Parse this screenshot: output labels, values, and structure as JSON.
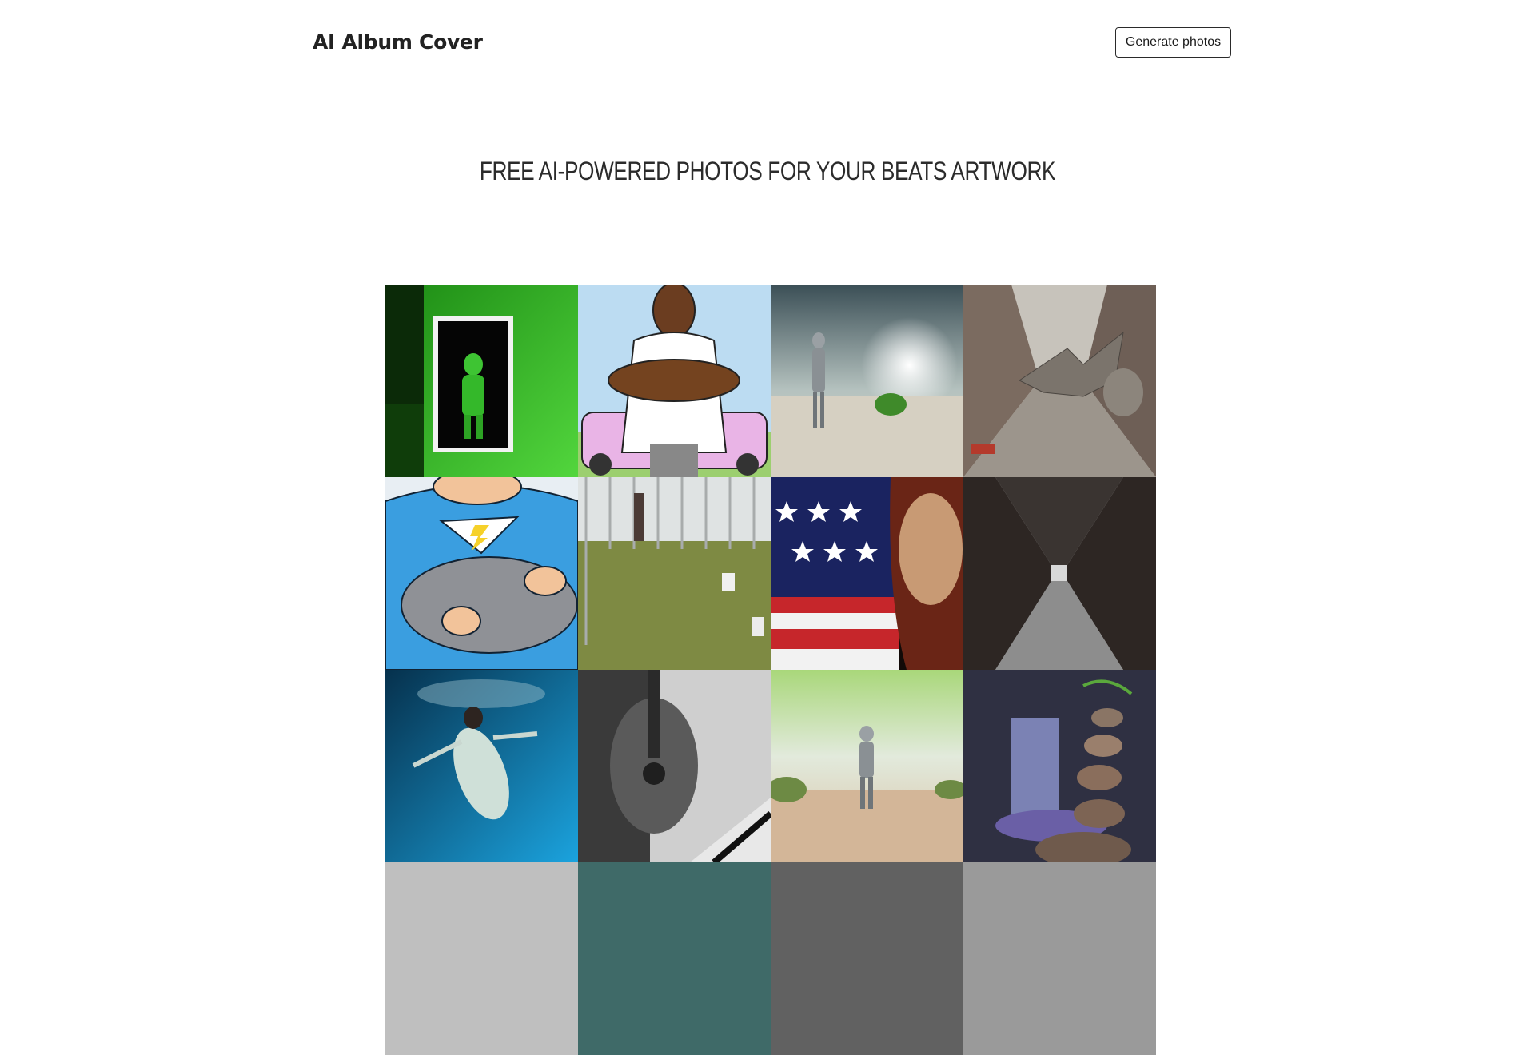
{
  "header": {
    "logo": "AI Album Cover",
    "cta_label": "Generate photos"
  },
  "hero": {
    "title": "FREE AI-POWERED PHOTOS FOR YOUR BEATS ARTWORK"
  },
  "gallery": {
    "tiles": [
      {
        "subject": "green mannequin figure in poster frame"
      },
      {
        "subject": "cartoon muscular man leaning on pink car"
      },
      {
        "subject": "robot walking in desert under sun"
      },
      {
        "subject": "dragon flying in old city street"
      },
      {
        "subject": "cartoon superhero holding boulder"
      },
      {
        "subject": "people sitting on grass by fence"
      },
      {
        "subject": "woman with american flag"
      },
      {
        "subject": "long dark hallway with doors"
      },
      {
        "subject": "figure floating underwater"
      },
      {
        "subject": "black and white guitar close-up"
      },
      {
        "subject": "robot walking on sand dunes"
      },
      {
        "subject": "stacked stones by waterfall"
      },
      {
        "subject": "partially visible image"
      },
      {
        "subject": "partially visible image"
      },
      {
        "subject": "partially visible image"
      },
      {
        "subject": "partially visible image"
      }
    ]
  },
  "colors": {
    "button_border": "#2a2a2a",
    "text": "#1b1b1b"
  }
}
